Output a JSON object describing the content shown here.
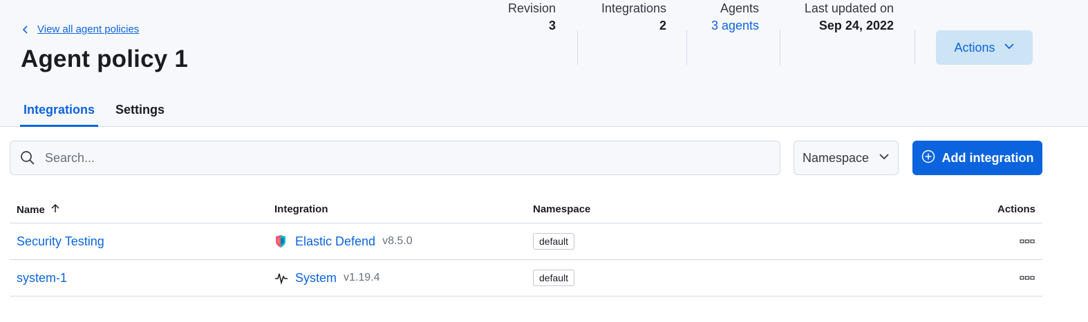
{
  "header": {
    "back_link": "View all agent policies",
    "title": "Agent policy 1",
    "stats": {
      "revision": {
        "label": "Revision",
        "value": "3"
      },
      "integrations": {
        "label": "Integrations",
        "value": "2"
      },
      "agents": {
        "label": "Agents",
        "value": "3 agents"
      },
      "last_updated": {
        "label": "Last updated on",
        "value": "Sep 24, 2022"
      }
    },
    "actions_label": "Actions"
  },
  "tabs": [
    {
      "label": "Integrations",
      "active": true
    },
    {
      "label": "Settings",
      "active": false
    }
  ],
  "toolbar": {
    "search_placeholder": "Search...",
    "namespace_label": "Namespace",
    "add_label": "Add integration"
  },
  "table": {
    "columns": [
      "Name",
      "Integration",
      "Namespace",
      "Actions"
    ],
    "rows": [
      {
        "name": "Security Testing",
        "integration": "Elastic Defend",
        "version": "v8.5.0",
        "namespace": "default",
        "icon": "elastic-defend-icon"
      },
      {
        "name": "system-1",
        "integration": "System",
        "version": "v1.19.4",
        "namespace": "default",
        "icon": "system-pulse-icon"
      }
    ]
  },
  "colors": {
    "accent": "#0b64dd",
    "header_bg": "#f7f8fc",
    "actions_bg": "#cce4f5",
    "border": "#d3dae6"
  }
}
